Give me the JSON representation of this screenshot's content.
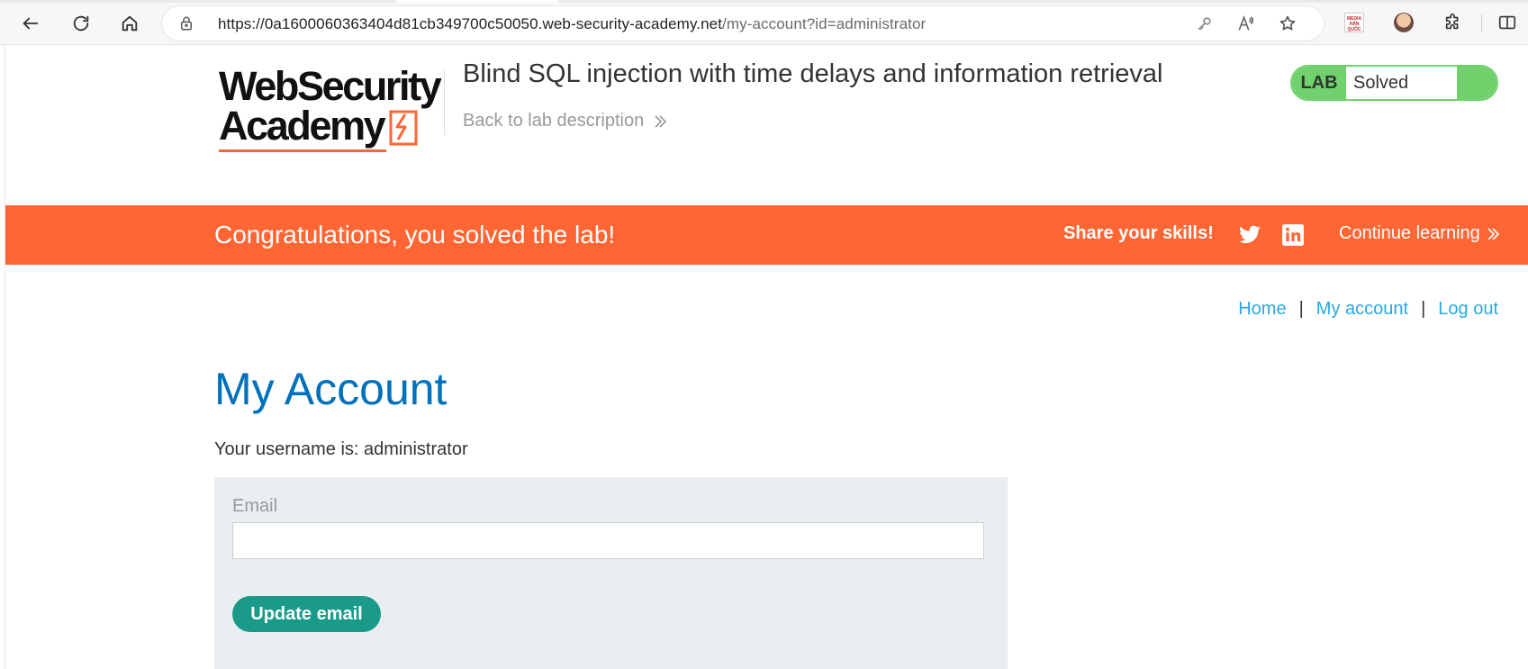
{
  "browser": {
    "url_host": "https://0a1600060363404d81cb349700c50050.web-security-academy.net",
    "url_path": "/my-account?id=administrator",
    "ext_badge_text": "MEDIA HẢN QUỐC"
  },
  "header": {
    "logo_line1": "WebSecurity",
    "logo_line2": "Academy",
    "lab_title": "Blind SQL injection with time delays and information retrieval",
    "back_link": "Back to lab description",
    "status_tag": "LAB",
    "status_value": "Solved"
  },
  "banner": {
    "message": "Congratulations, you solved the lab!",
    "share_text": "Share your skills!",
    "continue_link": "Continue learning"
  },
  "nav": {
    "home": "Home",
    "my_account": "My account",
    "log_out": "Log out",
    "separator": "|"
  },
  "main": {
    "title": "My Account",
    "username_line": "Your username is: administrator",
    "email_label": "Email",
    "email_value": "",
    "update_button": "Update email"
  },
  "colors": {
    "banner": "#ff6633",
    "title_blue": "#0071bc",
    "link_blue": "#29a8e0",
    "status_green": "#70d16d",
    "button_teal": "#1a9b8a",
    "form_bg": "#e8eef1"
  },
  "icons": {
    "back": "back-arrow-icon",
    "reload": "reload-icon",
    "home": "home-icon",
    "lock": "lock-icon",
    "key": "key-icon",
    "read_aloud": "read-aloud-icon",
    "favorite": "star-icon",
    "extensions": "puzzle-icon",
    "split_screen": "split-screen-icon",
    "twitter": "twitter-icon",
    "linkedin": "linkedin-icon",
    "chevron": "double-chevron-right-icon"
  }
}
